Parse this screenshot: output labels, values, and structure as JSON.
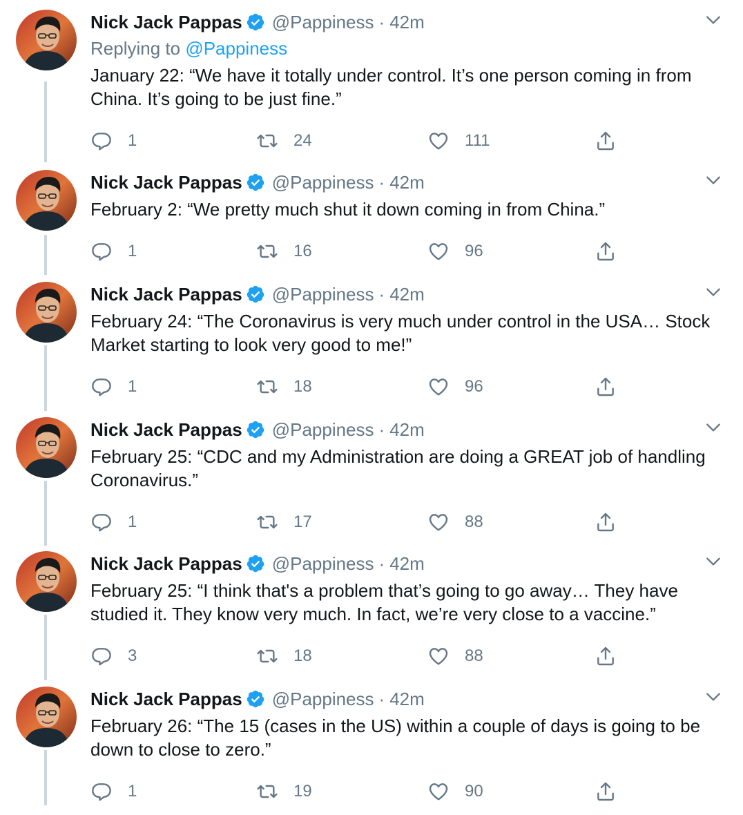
{
  "tweets": [
    {
      "name": "Nick Jack Pappas",
      "handle": "@Pappiness",
      "dot": "·",
      "time": "42m",
      "replying_prefix": "Replying to",
      "replying_to": "@Pappiness",
      "text": "January 22: “We have it totally under control. It’s one person coming in from China. It’s going to be just fine.”",
      "replies": "1",
      "retweets": "24",
      "likes": "111"
    },
    {
      "name": "Nick Jack Pappas",
      "handle": "@Pappiness",
      "dot": "·",
      "time": "42m",
      "text": "February 2: “We pretty much shut it down coming in from China.”",
      "replies": "1",
      "retweets": "16",
      "likes": "96"
    },
    {
      "name": "Nick Jack Pappas",
      "handle": "@Pappiness",
      "dot": "·",
      "time": "42m",
      "text": "February 24: “The Coronavirus is very much under control in the USA… Stock Market starting to look very good to me!”",
      "replies": "1",
      "retweets": "18",
      "likes": "96"
    },
    {
      "name": "Nick Jack Pappas",
      "handle": "@Pappiness",
      "dot": "·",
      "time": "42m",
      "text": "February 25: “CDC and my Administration are doing a GREAT job of handling Coronavirus.”",
      "replies": "1",
      "retweets": "17",
      "likes": "88"
    },
    {
      "name": "Nick Jack Pappas",
      "handle": "@Pappiness",
      "dot": "·",
      "time": "42m",
      "text": "February 25: “I think that's a problem that’s going to go away… They have studied it. They know very much. In fact, we’re very close to a vaccine.”",
      "replies": "3",
      "retweets": "18",
      "likes": "88"
    },
    {
      "name": "Nick Jack Pappas",
      "handle": "@Pappiness",
      "dot": "·",
      "time": "42m",
      "text": "February 26: “The 15 (cases in the US) within a couple of days is going to be down to close to zero.”",
      "replies": "1",
      "retweets": "19",
      "likes": "90"
    }
  ],
  "icons": {
    "verified": "verified-badge-icon",
    "chevron": "chevron-down-icon",
    "reply": "reply-bubble-icon",
    "retweet": "retweet-icon",
    "like": "heart-icon",
    "share": "share-icon"
  },
  "colors": {
    "text": "#14171a",
    "secondary": "#657786",
    "link": "#1da1f2",
    "thread_line": "#ccd6dd"
  }
}
